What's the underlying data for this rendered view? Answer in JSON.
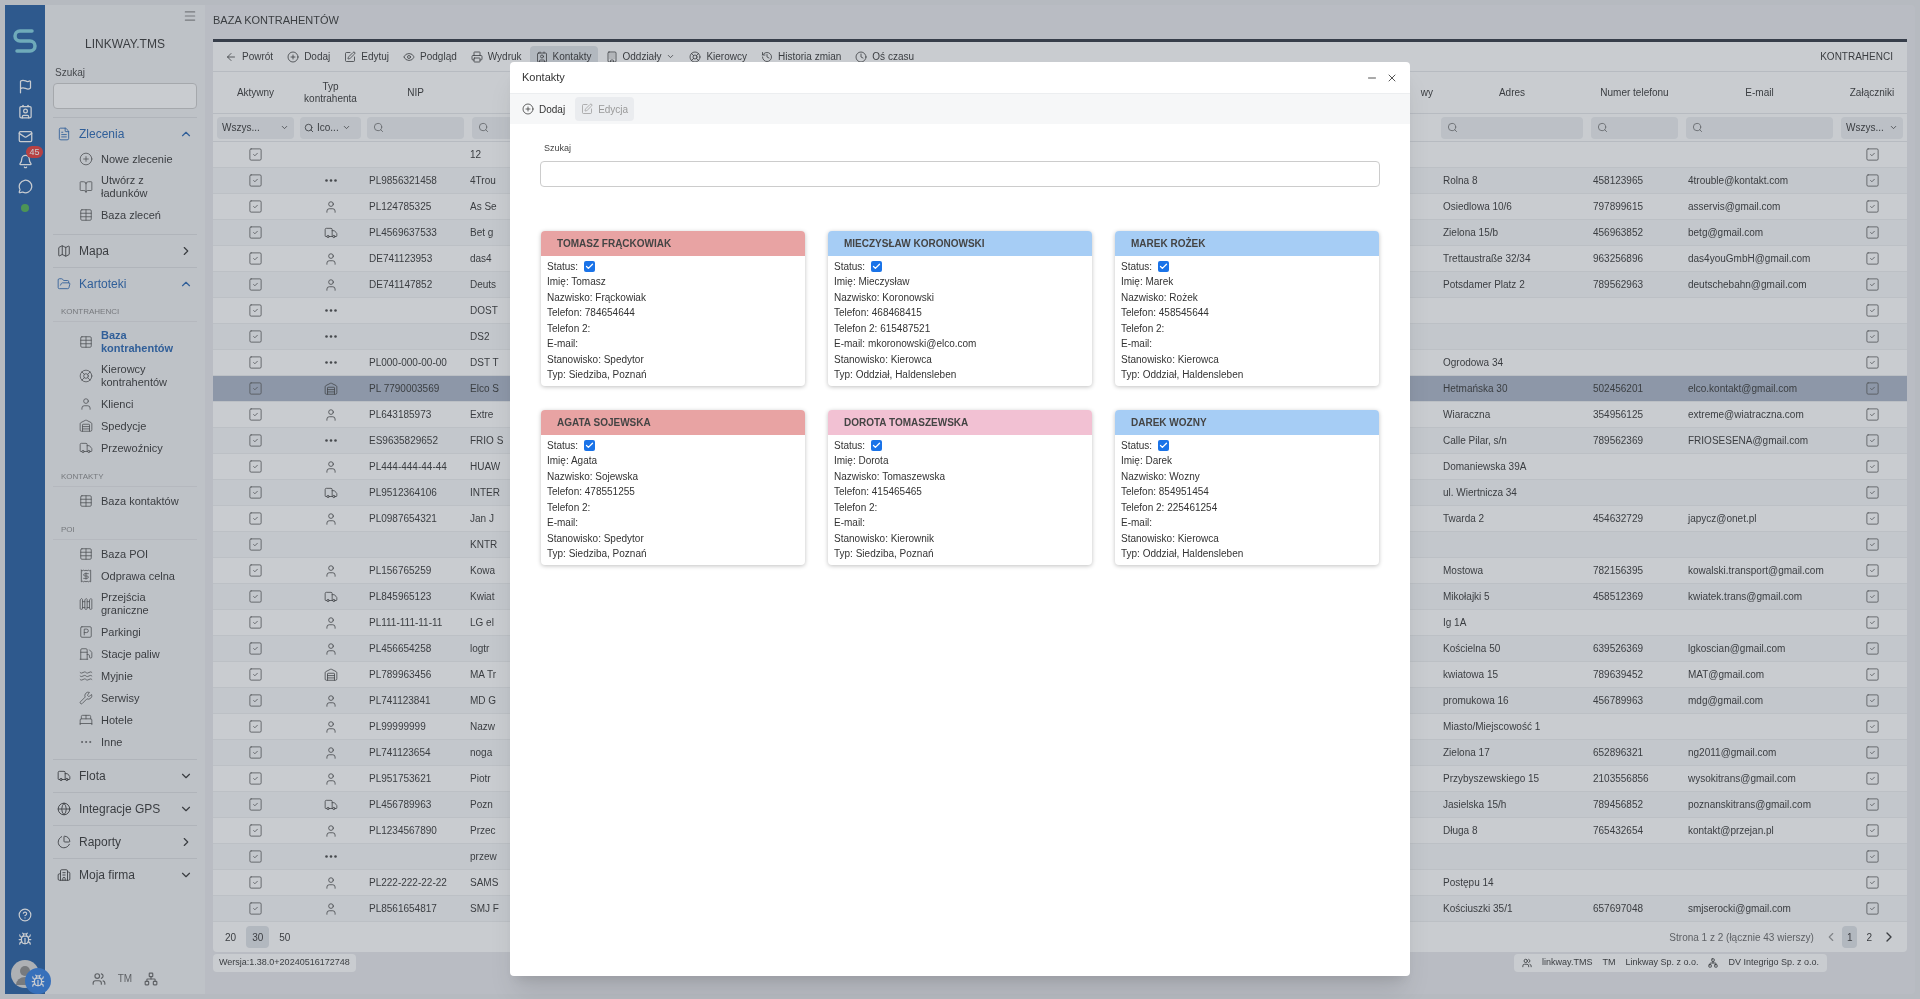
{
  "rail": {
    "notification_count": "45"
  },
  "sidebar": {
    "title": "LINKWAY.TMS",
    "search_label": "Szukaj",
    "footer_label": "TM",
    "sections": [
      {
        "label": "Zlecenia",
        "kind": "group",
        "expanded": true,
        "children": [
          {
            "label": "Nowe zlecenie",
            "selected": false
          },
          {
            "label": "Utwórz z ładunków",
            "selected": false
          },
          {
            "label": "Baza zleceń",
            "selected": false
          }
        ]
      },
      {
        "label": "Mapa",
        "kind": "link"
      },
      {
        "label": "Kartoteki",
        "kind": "group",
        "expanded": true,
        "headings": [
          {
            "label": "KONTRAHENCI",
            "children": [
              {
                "label": "Baza kontrahentów",
                "selected": true
              },
              {
                "label": "Kierowcy kontrahentów",
                "selected": false
              },
              {
                "label": "Klienci",
                "selected": false
              },
              {
                "label": "Spedycje",
                "selected": false
              },
              {
                "label": "Przewoźnicy",
                "selected": false
              }
            ]
          },
          {
            "label": "KONTAKTY",
            "children": [
              {
                "label": "Baza kontaktów",
                "selected": false
              }
            ]
          },
          {
            "label": "POI",
            "children": [
              {
                "label": "Baza POI",
                "selected": false
              },
              {
                "label": "Odprawa celna",
                "selected": false
              },
              {
                "label": "Przejścia graniczne",
                "selected": false
              },
              {
                "label": "Parkingi",
                "selected": false
              },
              {
                "label": "Stacje paliw",
                "selected": false
              },
              {
                "label": "Myjnie",
                "selected": false
              },
              {
                "label": "Serwisy",
                "selected": false
              },
              {
                "label": "Hotele",
                "selected": false
              },
              {
                "label": "Inne",
                "selected": false
              }
            ]
          }
        ]
      },
      {
        "label": "Flota",
        "kind": "group",
        "expanded": false
      },
      {
        "label": "Integracje GPS",
        "kind": "group",
        "expanded": false
      },
      {
        "label": "Raporty",
        "kind": "link"
      },
      {
        "label": "Moja firma",
        "kind": "group",
        "expanded": false
      }
    ]
  },
  "page_title": "BAZA KONTRAHENTÓW",
  "toolbar": {
    "items": [
      {
        "label": "Powrót",
        "selected": false,
        "dropdown": false
      },
      {
        "label": "Dodaj",
        "selected": false,
        "dropdown": false
      },
      {
        "label": "Edytuj",
        "selected": false,
        "dropdown": false
      },
      {
        "label": "Podgląd",
        "selected": false,
        "dropdown": false
      },
      {
        "label": "Wydruk",
        "selected": false,
        "dropdown": false
      },
      {
        "label": "Kontakty",
        "selected": true,
        "dropdown": false
      },
      {
        "label": "Oddziały",
        "selected": false,
        "dropdown": true
      },
      {
        "label": "Kierowcy",
        "selected": false,
        "dropdown": false
      },
      {
        "label": "Historia zmian",
        "selected": false,
        "dropdown": false
      },
      {
        "label": "Oś czasu",
        "selected": false,
        "dropdown": false
      }
    ],
    "section_label": "KONTRAHENCI"
  },
  "table": {
    "columns": [
      "Aktywny",
      "Typ kontrahenta",
      "NIP",
      "wy",
      "Adres",
      "Numer telefonu",
      "E-mail",
      "Załączniki"
    ],
    "filters": {
      "active": "Wszys...",
      "type": "Ico...",
      "attachments": "Wszys..."
    },
    "rows": [
      {
        "active": true,
        "kind": "none",
        "nip": "",
        "name": "12",
        "address": "",
        "phone": "",
        "email": "",
        "attachments": true,
        "selected": false
      },
      {
        "active": true,
        "kind": "other",
        "nip": "PL9856321458",
        "name": "4Trou",
        "address": "Rolna 8",
        "phone": "458123965",
        "email": "4trouble@kontakt.com",
        "attachments": true,
        "selected": false
      },
      {
        "active": true,
        "kind": "person",
        "nip": "PL124785325",
        "name": "As Se",
        "address": "Osiedlowa 10/6",
        "phone": "797899615",
        "email": "asservis@gmail.com",
        "attachments": true,
        "selected": false
      },
      {
        "active": true,
        "kind": "carrier",
        "nip": "PL4569637533",
        "name": "Bet g",
        "address": "Zielona 15/b",
        "phone": "456963852",
        "email": "betg@gmail.com",
        "attachments": true,
        "selected": false
      },
      {
        "active": true,
        "kind": "person",
        "nip": "DE741123953",
        "name": "das4",
        "address": "Trettaustraße 32/34",
        "phone": "963256896",
        "email": "das4youGmbH@gmail.com",
        "attachments": true,
        "selected": false
      },
      {
        "active": true,
        "kind": "person",
        "nip": "DE741147852",
        "name": "Deuts",
        "address": "Potsdamer Platz 2",
        "phone": "789562963",
        "email": "deutschebahn@gmail.com",
        "attachments": true,
        "selected": false
      },
      {
        "active": true,
        "kind": "other",
        "nip": "",
        "name": "DOST",
        "address": "",
        "phone": "",
        "email": "",
        "attachments": true,
        "selected": false
      },
      {
        "active": true,
        "kind": "other",
        "nip": "",
        "name": "DS2",
        "address": "",
        "phone": "",
        "email": "",
        "attachments": true,
        "selected": false
      },
      {
        "active": true,
        "kind": "other",
        "nip": "PL000-000-00-00",
        "name": "DST T",
        "address": "Ogrodowa 34",
        "phone": "",
        "email": "",
        "attachments": true,
        "selected": false
      },
      {
        "active": true,
        "kind": "forwarder",
        "nip": "PL 7790003569",
        "name": "Elco S",
        "address": "Hetmańska 30",
        "phone": "502456201",
        "email": "elco.kontakt@gmail.com",
        "attachments": true,
        "selected": true
      },
      {
        "active": true,
        "kind": "person",
        "nip": "PL643185973",
        "name": "Extre",
        "address": "Wiaraczna",
        "phone": "354956125",
        "email": "extreme@wiatraczna.com",
        "attachments": true,
        "selected": false
      },
      {
        "active": true,
        "kind": "other",
        "nip": "ES9635829652",
        "name": "FRIO S",
        "address": "Calle Pilar, s/n",
        "phone": "789562369",
        "email": "FRIOSESENA@gmail.com",
        "attachments": true,
        "selected": false
      },
      {
        "active": true,
        "kind": "person",
        "nip": "PL444-444-44-44",
        "name": "HUAW",
        "address": "Domaniewska 39A",
        "phone": "",
        "email": "",
        "attachments": true,
        "selected": false
      },
      {
        "active": true,
        "kind": "carrier",
        "nip": "PL9512364106",
        "name": "INTER",
        "address": "ul. Wiertnicza 34",
        "phone": "",
        "email": "",
        "attachments": true,
        "selected": false
      },
      {
        "active": true,
        "kind": "person",
        "nip": "PL0987654321",
        "name": "Jan J",
        "address": "Twarda 2",
        "phone": "454632729",
        "email": "japycz@onet.pl",
        "attachments": true,
        "selected": false
      },
      {
        "active": true,
        "kind": "none",
        "nip": "",
        "name": "KNTR",
        "address": "",
        "phone": "",
        "email": "",
        "attachments": true,
        "selected": false
      },
      {
        "active": true,
        "kind": "person",
        "nip": "PL156765259",
        "name": "Kowa",
        "address": "Mostowa",
        "phone": "782156395",
        "email": "kowalski.transport@gmail.com",
        "attachments": true,
        "selected": false
      },
      {
        "active": true,
        "kind": "carrier",
        "nip": "PL845965123",
        "name": "Kwiat",
        "address": "Mikołajki 5",
        "phone": "458512369",
        "email": "kwiatek.trans@gmail.com",
        "attachments": true,
        "selected": false
      },
      {
        "active": true,
        "kind": "person",
        "nip": "PL111-111-11-11",
        "name": "LG el",
        "address": "Ig 1A",
        "phone": "",
        "email": "",
        "attachments": true,
        "selected": false
      },
      {
        "active": true,
        "kind": "person",
        "nip": "PL456654258",
        "name": "logtr",
        "address": "Kościelna 50",
        "phone": "639526369",
        "email": "lgkoscian@gmail.com",
        "attachments": true,
        "selected": false
      },
      {
        "active": true,
        "kind": "forwarder",
        "nip": "PL789963456",
        "name": "MA Tr",
        "address": "kwiatowa 15",
        "phone": "789639452",
        "email": "MAT@gmail.com",
        "attachments": true,
        "selected": false
      },
      {
        "active": true,
        "kind": "person",
        "nip": "PL741123841",
        "name": "MD G",
        "address": "promukowa 16",
        "phone": "456789963",
        "email": "mdg@gmail.com",
        "attachments": true,
        "selected": false
      },
      {
        "active": true,
        "kind": "person",
        "nip": "PL99999999",
        "name": "Nazw",
        "address": "Miasto/Miejscowość 1",
        "phone": "",
        "email": "",
        "attachments": true,
        "selected": false
      },
      {
        "active": true,
        "kind": "person",
        "nip": "PL741123654",
        "name": "noga",
        "address": "Zielona 17",
        "phone": "652896321",
        "email": "ng2011@gmail.com",
        "attachments": true,
        "selected": false
      },
      {
        "active": true,
        "kind": "person",
        "nip": "PL951753621",
        "name": "Piotr",
        "address": "Przybyszewskiego 15",
        "phone": "2103556856",
        "email": "wysokitrans@gmail.com",
        "attachments": true,
        "selected": false
      },
      {
        "active": true,
        "kind": "carrier",
        "nip": "PL456789963",
        "name": "Pozn",
        "address": "Jasielska 15/h",
        "phone": "789456852",
        "email": "poznanskitrans@gmail.com",
        "attachments": true,
        "selected": false
      },
      {
        "active": true,
        "kind": "person",
        "nip": "PL1234567890",
        "name": "Przec",
        "address": "Długa 8",
        "phone": "765432654",
        "email": "kontakt@przejan.pl",
        "attachments": true,
        "selected": false
      },
      {
        "active": true,
        "kind": "other",
        "nip": "",
        "name": "przew",
        "address": "",
        "phone": "",
        "email": "",
        "attachments": true,
        "selected": false
      },
      {
        "active": true,
        "kind": "person",
        "nip": "PL222-222-22-22",
        "name": "SAMS",
        "address": "Postępu 14",
        "phone": "",
        "email": "",
        "attachments": true,
        "selected": false
      },
      {
        "active": true,
        "kind": "person",
        "nip": "PL8561654817",
        "name": "SMJ F",
        "address": "Kościuszki 35/1",
        "phone": "657697048",
        "email": "smjserocki@gmail.com",
        "attachments": true,
        "selected": false
      }
    ]
  },
  "pagination": {
    "sizes": [
      {
        "label": "20",
        "selected": false
      },
      {
        "label": "30",
        "selected": true
      },
      {
        "label": "50",
        "selected": false
      }
    ],
    "summary": "Strona 1 z 2 (łącznie 43 wierszy)",
    "pages": [
      {
        "label": "1",
        "selected": true
      },
      {
        "label": "2",
        "selected": false
      }
    ]
  },
  "footer": {
    "version": "Wersja:1.38.0+20240516172748",
    "app": "linkway.TMS",
    "tm": "TM",
    "owner": "Linkway Sp. z o.o.",
    "vendor": "DV Integrigo Sp. z o.o."
  },
  "modal": {
    "title": "Kontakty",
    "actions": [
      {
        "label": "Dodaj",
        "disabled": false
      },
      {
        "label": "Edycja",
        "disabled": true
      }
    ],
    "search_label": "Szukaj",
    "contacts": [
      {
        "name": "TOMASZ FRĄCKOWIAK",
        "color": "#e8a3a3",
        "status_label": "Status:",
        "status": true,
        "lines": [
          "Imię: Tomasz",
          "Nazwisko: Frąckowiak",
          "Telefon: 784654644",
          "Telefon 2:",
          "E-mail:",
          "Stanowisko: Spedytor",
          "Typ: Siedziba, Poznań"
        ]
      },
      {
        "name": "MIECZYSŁAW KORONOWSKI",
        "color": "#a6cdf5",
        "status_label": "Status:",
        "status": true,
        "lines": [
          "Imię: Mieczysław",
          "Nazwisko: Koronowski",
          "Telefon: 468468415",
          "Telefon 2: 615487521",
          "E-mail: mkoronowski@elco.com",
          "Stanowisko: Kierowca",
          "Typ: Oddział, Haldensleben"
        ]
      },
      {
        "name": "MAREK ROŻEK",
        "color": "#a6cdf5",
        "status_label": "Status:",
        "status": true,
        "lines": [
          "Imię: Marek",
          "Nazwisko: Rożek",
          "Telefon: 458545644",
          "Telefon 2:",
          "E-mail:",
          "Stanowisko: Kierowca",
          "Typ: Oddział, Haldensleben"
        ]
      },
      {
        "name": "AGATA SOJEWSKA",
        "color": "#e8a3a3",
        "status_label": "Status:",
        "status": true,
        "lines": [
          "Imię: Agata",
          "Nazwisko: Sojewska",
          "Telefon: 478551255",
          "Telefon 2:",
          "E-mail:",
          "Stanowisko: Spedytor",
          "Typ: Siedziba, Poznań"
        ]
      },
      {
        "name": "DOROTA TOMASZEWSKA",
        "color": "#f2c1d3",
        "status_label": "Status:",
        "status": true,
        "lines": [
          "Imię: Dorota",
          "Nazwisko: Tomaszewska",
          "Telefon: 415465465",
          "Telefon 2:",
          "E-mail:",
          "Stanowisko: Kierownik",
          "Typ: Siedziba, Poznań"
        ]
      },
      {
        "name": "DAREK WOZNY",
        "color": "#a6cdf5",
        "status_label": "Status:",
        "status": true,
        "lines": [
          "Imię: Darek",
          "Nazwisko: Wozny",
          "Telefon: 854951454",
          "Telefon 2: 225461254",
          "E-mail:",
          "Stanowisko: Kierowca",
          "Typ: Oddział, Haldensleben"
        ]
      }
    ]
  }
}
